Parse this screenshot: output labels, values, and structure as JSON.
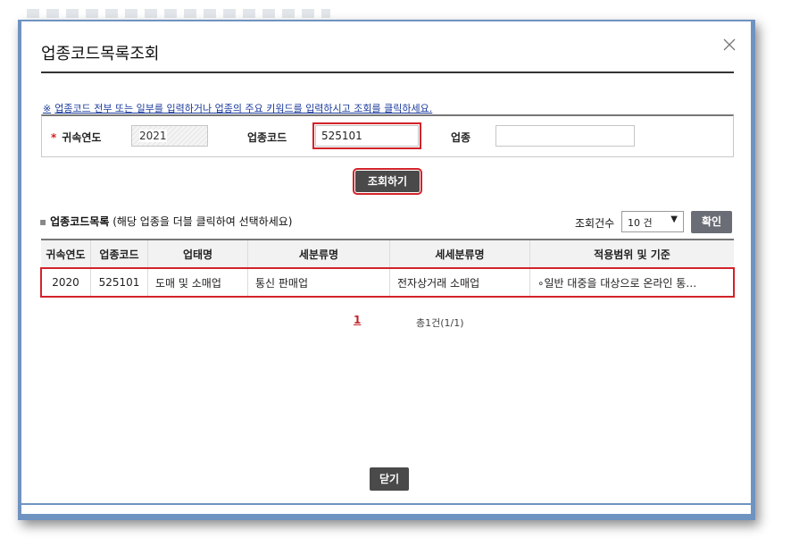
{
  "dialog": {
    "title": "업종코드목록조회"
  },
  "notice": {
    "bullet": "※",
    "text": "업종코드 전부 또는 일부를 입력하거나 업종의 주요 키워드를 입력하시고 조회를 클릭하세요."
  },
  "search": {
    "year_label": "귀속연도",
    "year_value": "2021",
    "code_label": "업종코드",
    "code_value": "525101",
    "industry_label": "업종",
    "industry_value": "",
    "search_button": "조회하기"
  },
  "list": {
    "title": "업종코드목록",
    "subtitle": "(해당 업종을 더블 클릭하여 선택하세요)",
    "count_label": "조회건수",
    "count_value": "10 건",
    "confirm_button": "확인",
    "columns": [
      "귀속연도",
      "업종코드",
      "업태명",
      "세분류명",
      "세세분류명",
      "적용범위 및 기준"
    ],
    "rows": [
      [
        "2020",
        "525101",
        "도매 및 소매업",
        "통신 판매업",
        "전자상거래 소매업",
        "∘일반 대중을 대상으로 온라인 통…"
      ]
    ]
  },
  "pagination": {
    "current": "1",
    "total": "총1건(1/1)"
  },
  "footer": {
    "close_button": "닫기"
  },
  "colors": {
    "highlight": "#d2232a",
    "frame": "#6f93c1",
    "button_dark": "#4a4a4a",
    "notice_link": "#1a3a9c"
  }
}
